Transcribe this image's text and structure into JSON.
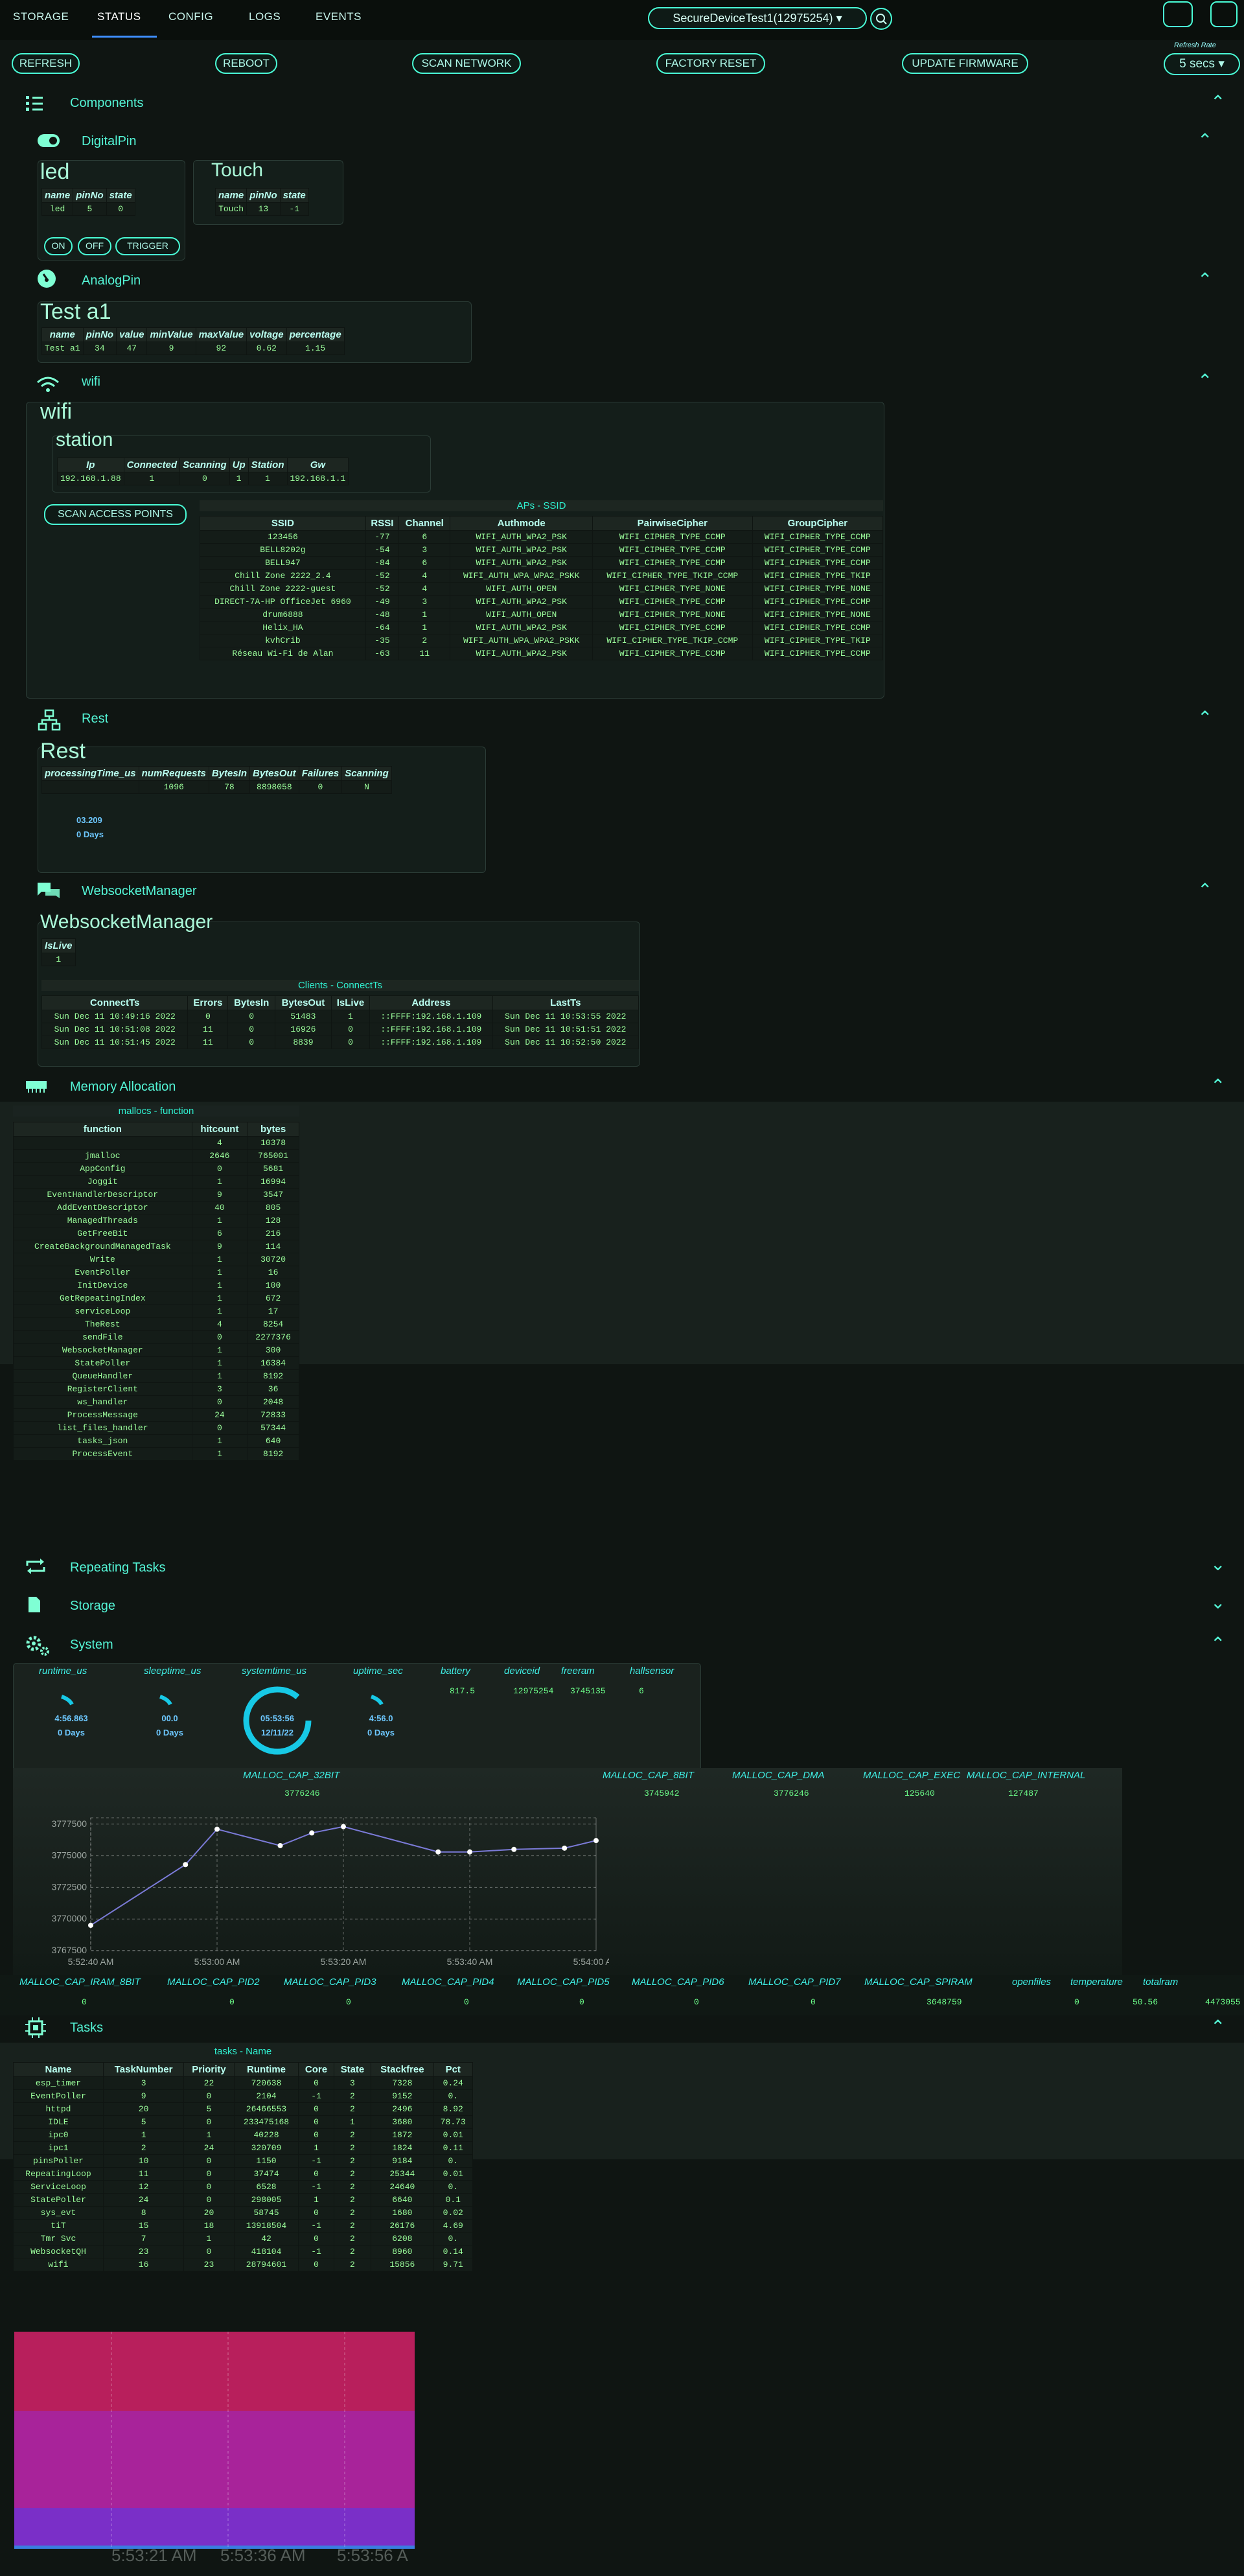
{
  "nav": {
    "tabs": [
      "STORAGE",
      "STATUS",
      "CONFIG",
      "LOGS",
      "EVENTS"
    ],
    "device": "SecureDeviceTest1(12975254)",
    "refresh_label": "Refresh Rate",
    "refresh_value": "5 secs"
  },
  "actions": [
    "REFRESH",
    "REBOOT",
    "SCAN NETWORK",
    "FACTORY RESET",
    "UPDATE FIRMWARE"
  ],
  "components": {
    "title": "Components"
  },
  "digital": {
    "title": "DigitalPin",
    "led": {
      "title": "led",
      "headers": [
        "name",
        "pinNo",
        "state"
      ],
      "row": [
        "led",
        "5",
        "0"
      ]
    },
    "touch": {
      "title": "Touch",
      "headers": [
        "name",
        "pinNo",
        "state"
      ],
      "row": [
        "Touch",
        "13",
        "-1"
      ]
    },
    "buttons": [
      "ON",
      "OFF",
      "TRIGGER"
    ]
  },
  "analog": {
    "title": "AnalogPin",
    "panel_title": "Test a1",
    "headers": [
      "name",
      "pinNo",
      "value",
      "minValue",
      "maxValue",
      "voltage",
      "percentage"
    ],
    "row": [
      "Test a1",
      "34",
      "47",
      "9",
      "92",
      "0.62",
      "1.15"
    ]
  },
  "wifi": {
    "title": "wifi",
    "panel_title": "wifi",
    "station": {
      "title": "station",
      "headers": [
        "Ip",
        "Connected",
        "Scanning",
        "Up",
        "Station",
        "Gw"
      ],
      "row": [
        "192.168.1.88",
        "1",
        "0",
        "1",
        "1",
        "192.168.1.1"
      ]
    },
    "scan_button": "SCAN ACCESS POINTS",
    "aps_caption": "APs - SSID",
    "aps_headers": [
      "SSID",
      "RSSI",
      "Channel",
      "Authmode",
      "PairwiseCipher",
      "GroupCipher"
    ],
    "aps": [
      [
        "123456",
        "-77",
        "6",
        "WIFI_AUTH_WPA2_PSK",
        "WIFI_CIPHER_TYPE_CCMP",
        "WIFI_CIPHER_TYPE_CCMP"
      ],
      [
        "BELL8202g",
        "-54",
        "3",
        "WIFI_AUTH_WPA2_PSK",
        "WIFI_CIPHER_TYPE_CCMP",
        "WIFI_CIPHER_TYPE_CCMP"
      ],
      [
        "BELL947",
        "-84",
        "6",
        "WIFI_AUTH_WPA2_PSK",
        "WIFI_CIPHER_TYPE_CCMP",
        "WIFI_CIPHER_TYPE_CCMP"
      ],
      [
        "Chill Zone 2222_2.4",
        "-52",
        "4",
        "WIFI_AUTH_WPA_WPA2_PSKK",
        "WIFI_CIPHER_TYPE_TKIP_CCMP",
        "WIFI_CIPHER_TYPE_TKIP"
      ],
      [
        "Chill Zone 2222-guest",
        "-52",
        "4",
        "WIFI_AUTH_OPEN",
        "WIFI_CIPHER_TYPE_NONE",
        "WIFI_CIPHER_TYPE_NONE"
      ],
      [
        "DIRECT-7A-HP OfficeJet 6960",
        "-49",
        "3",
        "WIFI_AUTH_WPA2_PSK",
        "WIFI_CIPHER_TYPE_CCMP",
        "WIFI_CIPHER_TYPE_CCMP"
      ],
      [
        "drum6888",
        "-48",
        "1",
        "WIFI_AUTH_OPEN",
        "WIFI_CIPHER_TYPE_NONE",
        "WIFI_CIPHER_TYPE_NONE"
      ],
      [
        "Helix_HA",
        "-64",
        "1",
        "WIFI_AUTH_WPA2_PSK",
        "WIFI_CIPHER_TYPE_CCMP",
        "WIFI_CIPHER_TYPE_CCMP"
      ],
      [
        "kvhCrib",
        "-35",
        "2",
        "WIFI_AUTH_WPA_WPA2_PSKK",
        "WIFI_CIPHER_TYPE_TKIP_CCMP",
        "WIFI_CIPHER_TYPE_TKIP"
      ],
      [
        "Réseau Wi-Fi de Alan",
        "-63",
        "11",
        "WIFI_AUTH_WPA2_PSK",
        "WIFI_CIPHER_TYPE_CCMP",
        "WIFI_CIPHER_TYPE_CCMP"
      ]
    ]
  },
  "rest": {
    "title": "Rest",
    "panel_title": "Rest",
    "headers": [
      "processingTime_us",
      "numRequests",
      "BytesIn",
      "BytesOut",
      "Failures",
      "Scanning"
    ],
    "row": [
      "",
      "1096",
      "78",
      "8898058",
      "0",
      "N"
    ],
    "time": "03.209",
    "days": "0 Days"
  },
  "ws": {
    "title": "WebsocketManager",
    "panel_title": "WebsocketManager",
    "islive_label": "IsLive",
    "islive_value": "1",
    "clients_caption": "Clients - ConnectTs",
    "headers": [
      "ConnectTs",
      "Errors",
      "BytesIn",
      "BytesOut",
      "IsLive",
      "Address",
      "LastTs"
    ],
    "rows": [
      [
        "Sun Dec 11 10:49:16 2022",
        "0",
        "0",
        "51483",
        "1",
        "::FFFF:192.168.1.109",
        "Sun Dec 11 10:53:55 2022"
      ],
      [
        "Sun Dec 11 10:51:08 2022",
        "11",
        "0",
        "16926",
        "0",
        "::FFFF:192.168.1.109",
        "Sun Dec 11 10:51:51 2022"
      ],
      [
        "Sun Dec 11 10:51:45 2022",
        "11",
        "0",
        "8839",
        "0",
        "::FFFF:192.168.1.109",
        "Sun Dec 11 10:52:50 2022"
      ]
    ]
  },
  "memory": {
    "title": "Memory Allocation",
    "caption": "mallocs - function",
    "headers": [
      "function",
      "hitcount",
      "bytes"
    ],
    "rows": [
      [
        "",
        "4",
        "10378"
      ],
      [
        "jmalloc",
        "2646",
        "765001"
      ],
      [
        "AppConfig",
        "0",
        "5681"
      ],
      [
        "Joggit",
        "1",
        "16994"
      ],
      [
        "EventHandlerDescriptor",
        "9",
        "3547"
      ],
      [
        "AddEventDescriptor",
        "40",
        "805"
      ],
      [
        "ManagedThreads",
        "1",
        "128"
      ],
      [
        "GetFreeBit",
        "6",
        "216"
      ],
      [
        "CreateBackgroundManagedTask",
        "9",
        "114"
      ],
      [
        "Write",
        "1",
        "30720"
      ],
      [
        "EventPoller",
        "1",
        "16"
      ],
      [
        "InitDevice",
        "1",
        "100"
      ],
      [
        "GetRepeatingIndex",
        "1",
        "672"
      ],
      [
        "serviceLoop",
        "1",
        "17"
      ],
      [
        "TheRest",
        "4",
        "8254"
      ],
      [
        "sendFile",
        "0",
        "2277376"
      ],
      [
        "WebsocketManager",
        "1",
        "300"
      ],
      [
        "StatePoller",
        "1",
        "16384"
      ],
      [
        "QueueHandler",
        "1",
        "8192"
      ],
      [
        "RegisterClient",
        "3",
        "36"
      ],
      [
        "ws_handler",
        "0",
        "2048"
      ],
      [
        "ProcessMessage",
        "24",
        "72833"
      ],
      [
        "list_files_handler",
        "0",
        "57344"
      ],
      [
        "tasks_json",
        "1",
        "640"
      ],
      [
        "ProcessEvent",
        "1",
        "8192"
      ]
    ]
  },
  "repeating": {
    "title": "Repeating Tasks"
  },
  "storage": {
    "title": "Storage"
  },
  "system": {
    "title": "System",
    "gauges": [
      {
        "label": "runtime_us",
        "v1": "4:56.863",
        "v2": "0 Days"
      },
      {
        "label": "sleeptime_us",
        "v1": "00.0",
        "v2": "0 Days"
      },
      {
        "label": "systemtime_us",
        "v1": "05:53:56",
        "v2": "12/11/22"
      },
      {
        "label": "uptime_sec",
        "v1": "4:56.0",
        "v2": "0 Days"
      }
    ],
    "stats": [
      {
        "label": "battery",
        "value": "817.5"
      },
      {
        "label": "deviceid",
        "value": "12975254"
      },
      {
        "label": "freeram",
        "value": "3745135"
      },
      {
        "label": "hallsensor",
        "value": "6"
      }
    ],
    "malloc_top": [
      {
        "label": "MALLOC_CAP_32BIT",
        "value": "3776246"
      },
      {
        "label": "MALLOC_CAP_8BIT",
        "value": "3745942"
      },
      {
        "label": "MALLOC_CAP_DMA",
        "value": "3776246"
      },
      {
        "label": "MALLOC_CAP_EXEC",
        "value": "125640"
      },
      {
        "label": "MALLOC_CAP_INTERNAL",
        "value": "127487"
      }
    ],
    "malloc_bottom": [
      {
        "label": "MALLOC_CAP_IRAM_8BIT",
        "value": "0"
      },
      {
        "label": "MALLOC_CAP_PID2",
        "value": "0"
      },
      {
        "label": "MALLOC_CAP_PID3",
        "value": "0"
      },
      {
        "label": "MALLOC_CAP_PID4",
        "value": "0"
      },
      {
        "label": "MALLOC_CAP_PID5",
        "value": "0"
      },
      {
        "label": "MALLOC_CAP_PID6",
        "value": "0"
      },
      {
        "label": "MALLOC_CAP_PID7",
        "value": "0"
      },
      {
        "label": "MALLOC_CAP_SPIRAM",
        "value": "3648759"
      },
      {
        "label": "openfiles",
        "value": "0"
      },
      {
        "label": "temperature",
        "value": "50.56"
      },
      {
        "label": "totalram",
        "value": "4473055"
      }
    ]
  },
  "chart_data": {
    "type": "line",
    "x": [
      "5:52:40 AM",
      "5:52:55 AM",
      "5:53:00 AM",
      "5:53:10 AM",
      "5:53:15 AM",
      "5:53:20 AM",
      "5:53:35 AM",
      "5:53:40 AM",
      "5:53:47 AM",
      "5:53:55 AM",
      "5:54:00 AM"
    ],
    "values": [
      3769500,
      3774300,
      3777100,
      3775800,
      3776800,
      3777300,
      3775300,
      3775300,
      3775500,
      3775600,
      3776200
    ],
    "ylim": [
      3767500,
      3778000
    ],
    "yticks": [
      "3767500",
      "3770000",
      "3772500",
      "3775000",
      "3777500"
    ],
    "xticks": [
      "5:52:40 AM",
      "5:53:00 AM",
      "5:53:20 AM",
      "5:53:40 AM",
      "5:54:00 AM"
    ],
    "grid": true,
    "color": "#7b7bd8"
  },
  "tasks": {
    "title": "Tasks",
    "caption": "tasks - Name",
    "headers": [
      "Name",
      "TaskNumber",
      "Priority",
      "Runtime",
      "Core",
      "State",
      "Stackfree",
      "Pct"
    ],
    "rows": [
      [
        "esp_timer",
        "3",
        "22",
        "720638",
        "0",
        "3",
        "7328",
        "0.24"
      ],
      [
        "EventPoller",
        "9",
        "0",
        "2104",
        "-1",
        "2",
        "9152",
        "0."
      ],
      [
        "httpd",
        "20",
        "5",
        "26466553",
        "0",
        "2",
        "2496",
        "8.92"
      ],
      [
        "IDLE",
        "5",
        "0",
        "233475168",
        "0",
        "1",
        "3680",
        "78.73"
      ],
      [
        "ipc0",
        "1",
        "1",
        "40228",
        "0",
        "2",
        "1872",
        "0.01"
      ],
      [
        "ipc1",
        "2",
        "24",
        "320709",
        "1",
        "2",
        "1824",
        "0.11"
      ],
      [
        "pinsPoller",
        "10",
        "0",
        "1150",
        "-1",
        "2",
        "9184",
        "0."
      ],
      [
        "RepeatingLoop",
        "11",
        "0",
        "37474",
        "0",
        "2",
        "25344",
        "0.01"
      ],
      [
        "ServiceLoop",
        "12",
        "0",
        "6528",
        "-1",
        "2",
        "24640",
        "0."
      ],
      [
        "StatePoller",
        "24",
        "0",
        "298005",
        "1",
        "2",
        "6640",
        "0.1"
      ],
      [
        "sys_evt",
        "8",
        "20",
        "58745",
        "0",
        "2",
        "1680",
        "0.02"
      ],
      [
        "tiT",
        "15",
        "18",
        "13918504",
        "-1",
        "2",
        "26176",
        "4.69"
      ],
      [
        "Tmr Svc",
        "7",
        "1",
        "42",
        "0",
        "2",
        "6208",
        "0."
      ],
      [
        "WebsocketQH",
        "23",
        "0",
        "418104",
        "-1",
        "2",
        "8960",
        "0.14"
      ],
      [
        "wifi",
        "16",
        "23",
        "28794601",
        "0",
        "2",
        "15856",
        "9.71"
      ]
    ],
    "xticks": [
      "5:53:21 AM",
      "5:53:36 AM",
      "5:53:56 A"
    ]
  }
}
